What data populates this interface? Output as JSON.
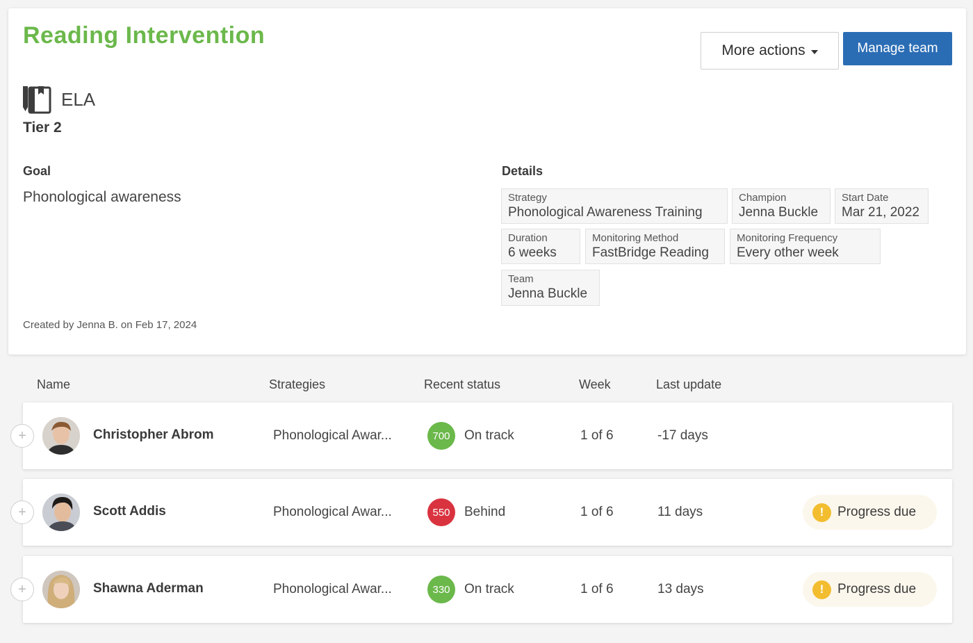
{
  "header": {
    "title": "Reading Intervention",
    "more_actions_label": "More actions",
    "manage_team_label": "Manage team"
  },
  "subject": {
    "icon": "book-pencil-icon",
    "label": "ELA",
    "tier": "Tier 2"
  },
  "goal": {
    "heading": "Goal",
    "text": "Phonological awareness"
  },
  "created_text": "Created by Jenna B. on Feb 17, 2024",
  "details": {
    "heading": "Details",
    "items": [
      {
        "key": "Strategy",
        "value": "Phonological Awareness Training"
      },
      {
        "key": "Champion",
        "value": "Jenna Buckle"
      },
      {
        "key": "Start Date",
        "value": "Mar 21, 2022"
      },
      {
        "key": "Duration",
        "value": "6 weeks"
      },
      {
        "key": "Monitoring Method",
        "value": "FastBridge Reading"
      },
      {
        "key": "Monitoring Frequency",
        "value": "Every other week"
      },
      {
        "key": "Team",
        "value": "Jenna Buckle"
      }
    ]
  },
  "table": {
    "columns": [
      "Name",
      "Strategies",
      "Recent status",
      "Week",
      "Last update"
    ],
    "rows": [
      {
        "name": "Christopher Abrom",
        "strategy": "Phonological Awar...",
        "score": "700",
        "score_color": "#6bb84b",
        "status": "On track",
        "week": "1 of 6",
        "last_update": "-17 days",
        "badge": ""
      },
      {
        "name": "Scott Addis",
        "strategy": "Phonological Awar...",
        "score": "550",
        "score_color": "#d9333f",
        "status": "Behind",
        "week": "1 of 6",
        "last_update": "11 days",
        "badge": "Progress due"
      },
      {
        "name": "Shawna Aderman",
        "strategy": "Phonological Awar...",
        "score": "330",
        "score_color": "#6bb84b",
        "status": "On track",
        "week": "1 of 6",
        "last_update": "13 days",
        "badge": "Progress due"
      }
    ]
  },
  "colors": {
    "title": "#6bb84b",
    "primary_button": "#2b6db5",
    "on_track": "#6bb84b",
    "behind": "#d9333f",
    "warning": "#f2bd2f"
  }
}
